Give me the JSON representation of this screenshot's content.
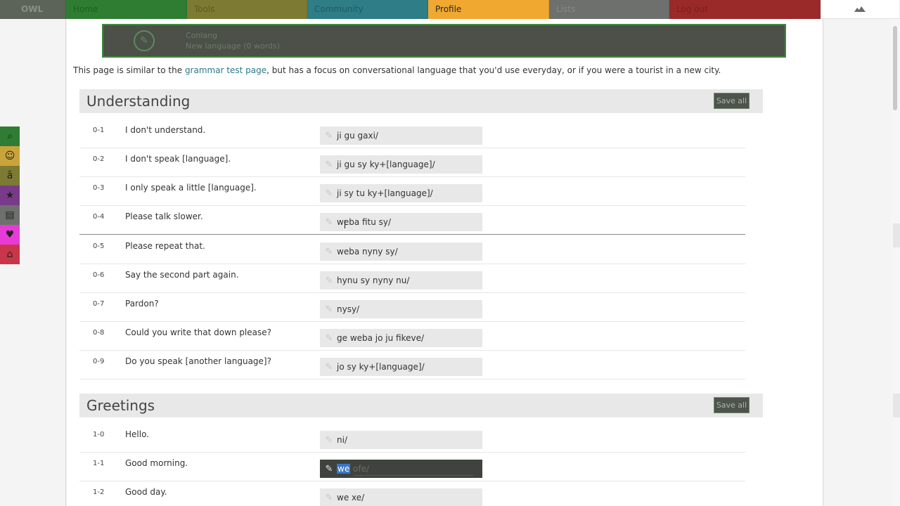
{
  "nav": {
    "logo": "OWL",
    "tabs": [
      {
        "label": "Home"
      },
      {
        "label": "Tools"
      },
      {
        "label": "Community"
      },
      {
        "label": "Profile"
      },
      {
        "label": "Lists"
      },
      {
        "label": "Log out"
      }
    ],
    "settings_icon": "settings-icon"
  },
  "banner": {
    "line1": "Conlang",
    "line2": "New language (0 words)"
  },
  "intro": {
    "before": "This page is similar to the ",
    "link": "grammar test page",
    "after": ", but has a focus on conversational language that you'd use everyday, or if you were a tourist in a new city."
  },
  "sections": [
    {
      "title": "Understanding",
      "save_all": "Save all",
      "rows": [
        {
          "num": "0-1",
          "phrase": "I don't understand.",
          "answer": "ji gu gaxi/"
        },
        {
          "num": "0-2",
          "phrase": "I don't speak [language].",
          "answer": "ji gu sy ky+[language]/"
        },
        {
          "num": "0-3",
          "phrase": "I only speak a little [language].",
          "answer": "ji sy tu ky+[language]/"
        },
        {
          "num": "0-4",
          "phrase": "Please talk slower.",
          "answer": "weba fitu sy/"
        },
        {
          "num": "0-5",
          "phrase": "Please repeat that.",
          "answer": "weba nyny sy/"
        },
        {
          "num": "0-6",
          "phrase": "Say the second part again.",
          "answer": "hynu sy nyny nu/"
        },
        {
          "num": "0-7",
          "phrase": "Pardon?",
          "answer": "nysy/"
        },
        {
          "num": "0-8",
          "phrase": "Could you write that down please?",
          "answer": "ge weba jo ju fikeve/"
        },
        {
          "num": "0-9",
          "phrase": "Do you speak [another language]?",
          "answer": "jo sy ky+[language]/"
        }
      ]
    },
    {
      "title": "Greetings",
      "save_all": "Save all",
      "rows": [
        {
          "num": "1-0",
          "phrase": "Hello.",
          "answer": "ni/"
        },
        {
          "num": "1-1",
          "phrase": "Good morning.",
          "answer_selected": "we",
          "answer_rest": " ofe/"
        },
        {
          "num": "1-2",
          "phrase": "Good day.",
          "answer": "we xe/"
        }
      ]
    }
  ],
  "side_icons": [
    "search-icon",
    "people-icon",
    "translate-icon",
    "star-icon",
    "notebook-icon",
    "heart-icon",
    "home-icon"
  ],
  "side_icon_colors": [
    "#2e7d32",
    "#c9a43a",
    "#7d7a34",
    "#7a3a8a",
    "#6e706e",
    "#e83ad6",
    "#c9364a"
  ]
}
